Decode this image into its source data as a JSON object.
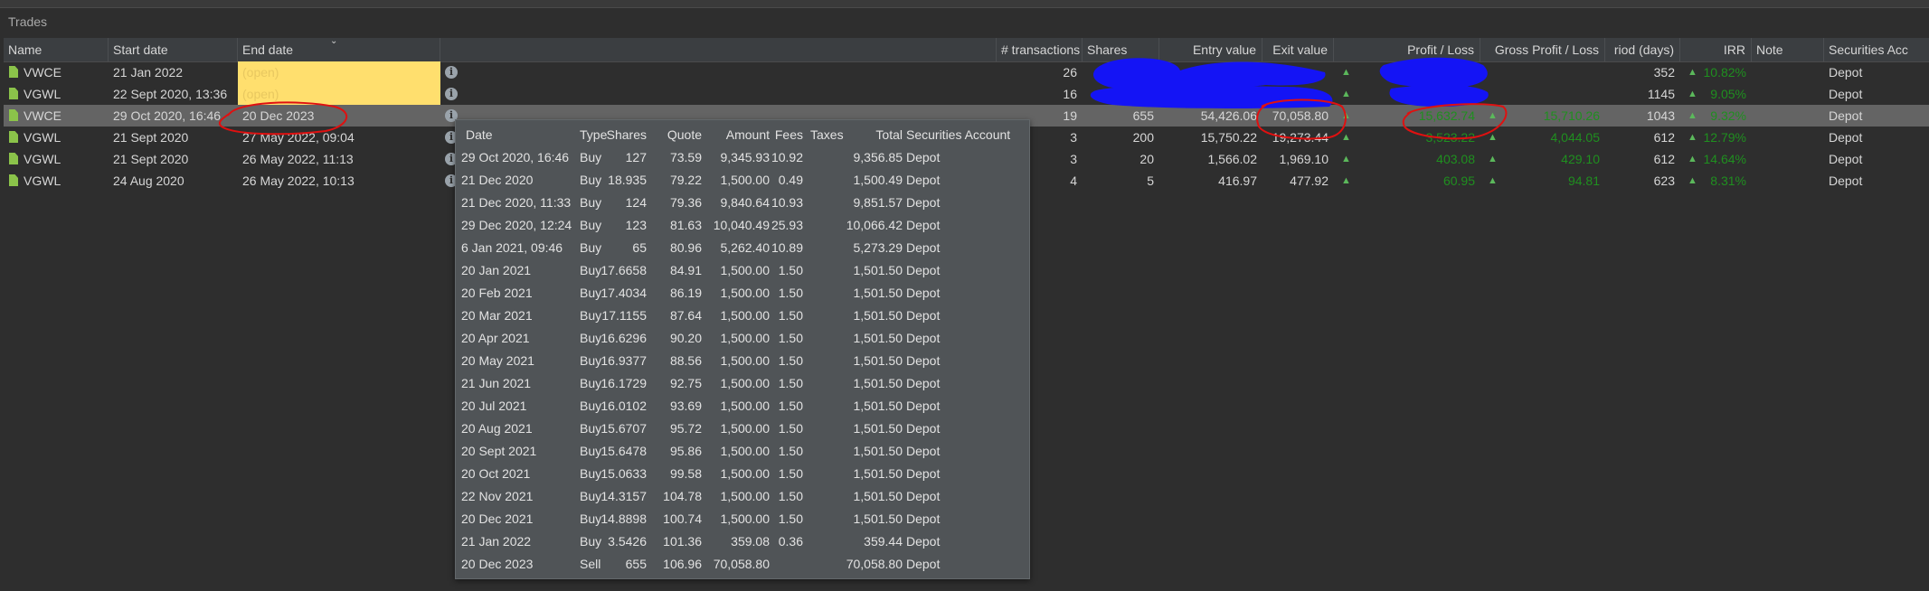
{
  "panel_title": "Trades",
  "columns": {
    "name": "Name",
    "start": "Start date",
    "end": "End date",
    "trans": "# transactions",
    "shares": "Shares",
    "entry": "Entry value",
    "exit": "Exit value",
    "pl": "Profit / Loss",
    "gross": "Gross Profit / Loss",
    "period": "riod (days)",
    "irr": "IRR",
    "note": "Note",
    "acc": "Securities Acc"
  },
  "rows": [
    {
      "name": "VWCE",
      "start": "21 Jan 2022",
      "end": "(open)",
      "trans": "26",
      "shares": "",
      "entry": "",
      "exit": "",
      "pl": "",
      "gross": "",
      "period": "352",
      "irr": "10.82%",
      "acc": "Depot"
    },
    {
      "name": "VGWL",
      "start": "22 Sept 2020, 13:36",
      "end": "(open)",
      "trans": "16",
      "shares": "",
      "entry": "",
      "exit": "",
      "pl": "",
      "gross": "",
      "period": "1145",
      "irr": "9.05%",
      "acc": "Depot"
    },
    {
      "name": "VWCE",
      "start": "29 Oct 2020, 16:46",
      "end": "20 Dec 2023",
      "trans": "19",
      "shares": "655",
      "entry": "54,426.06",
      "exit": "70,058.80",
      "pl": "15,632.74",
      "gross": "15,710.26",
      "period": "1043",
      "irr": "9.32%",
      "acc": "Depot"
    },
    {
      "name": "VGWL",
      "start": "21 Sept 2020",
      "end": "27 May 2022, 09:04",
      "trans": "3",
      "shares": "200",
      "entry": "15,750.22",
      "exit": "19,273.44",
      "pl": "3,523.22",
      "gross": "4,044.05",
      "period": "612",
      "irr": "12.79%",
      "acc": "Depot"
    },
    {
      "name": "VGWL",
      "start": "21 Sept 2020",
      "end": "26 May 2022, 11:13",
      "trans": "3",
      "shares": "20",
      "entry": "1,566.02",
      "exit": "1,969.10",
      "pl": "403.08",
      "gross": "429.10",
      "period": "612",
      "irr": "14.64%",
      "acc": "Depot"
    },
    {
      "name": "VGWL",
      "start": "24 Aug 2020",
      "end": "26 May 2022, 10:13",
      "trans": "4",
      "shares": "5",
      "entry": "416.97",
      "exit": "477.92",
      "pl": "60.95",
      "gross": "94.81",
      "period": "623",
      "irr": "8.31%",
      "acc": "Depot"
    }
  ],
  "icons": {
    "arrow": "▲",
    "info": "i",
    "sort": "⌄"
  },
  "tooltip": {
    "headers": {
      "date": "Date",
      "type": "Type",
      "shares": "Shares",
      "quote": "Quote",
      "amount": "Amount",
      "fees": "Fees",
      "taxes": "Taxes",
      "total": "Total",
      "acc": "Securities Account"
    },
    "rows": [
      {
        "date": "29 Oct 2020, 16:46",
        "type": "Buy",
        "shares": "127",
        "quote": "73.59",
        "amount": "9,345.93",
        "fees": "10.92",
        "total": "9,356.85",
        "acc": "Depot"
      },
      {
        "date": "21 Dec 2020",
        "type": "Buy",
        "shares": "18.935",
        "quote": "79.22",
        "amount": "1,500.00",
        "fees": "0.49",
        "total": "1,500.49",
        "acc": "Depot"
      },
      {
        "date": "21 Dec 2020, 11:33",
        "type": "Buy",
        "shares": "124",
        "quote": "79.36",
        "amount": "9,840.64",
        "fees": "10.93",
        "total": "9,851.57",
        "acc": "Depot"
      },
      {
        "date": "29 Dec 2020, 12:24",
        "type": "Buy",
        "shares": "123",
        "quote": "81.63",
        "amount": "10,040.49",
        "fees": "25.93",
        "total": "10,066.42",
        "acc": "Depot"
      },
      {
        "date": "6 Jan 2021, 09:46",
        "type": "Buy",
        "shares": "65",
        "quote": "80.96",
        "amount": "5,262.40",
        "fees": "10.89",
        "total": "5,273.29",
        "acc": "Depot"
      },
      {
        "date": "20 Jan 2021",
        "type": "Buy",
        "shares": "17.6658",
        "quote": "84.91",
        "amount": "1,500.00",
        "fees": "1.50",
        "total": "1,501.50",
        "acc": "Depot"
      },
      {
        "date": "20 Feb 2021",
        "type": "Buy",
        "shares": "17.4034",
        "quote": "86.19",
        "amount": "1,500.00",
        "fees": "1.50",
        "total": "1,501.50",
        "acc": "Depot"
      },
      {
        "date": "20 Mar 2021",
        "type": "Buy",
        "shares": "17.1155",
        "quote": "87.64",
        "amount": "1,500.00",
        "fees": "1.50",
        "total": "1,501.50",
        "acc": "Depot"
      },
      {
        "date": "20 Apr 2021",
        "type": "Buy",
        "shares": "16.6296",
        "quote": "90.20",
        "amount": "1,500.00",
        "fees": "1.50",
        "total": "1,501.50",
        "acc": "Depot"
      },
      {
        "date": "20 May 2021",
        "type": "Buy",
        "shares": "16.9377",
        "quote": "88.56",
        "amount": "1,500.00",
        "fees": "1.50",
        "total": "1,501.50",
        "acc": "Depot"
      },
      {
        "date": "21 Jun 2021",
        "type": "Buy",
        "shares": "16.1729",
        "quote": "92.75",
        "amount": "1,500.00",
        "fees": "1.50",
        "total": "1,501.50",
        "acc": "Depot"
      },
      {
        "date": "20 Jul 2021",
        "type": "Buy",
        "shares": "16.0102",
        "quote": "93.69",
        "amount": "1,500.00",
        "fees": "1.50",
        "total": "1,501.50",
        "acc": "Depot"
      },
      {
        "date": "20 Aug 2021",
        "type": "Buy",
        "shares": "15.6707",
        "quote": "95.72",
        "amount": "1,500.00",
        "fees": "1.50",
        "total": "1,501.50",
        "acc": "Depot"
      },
      {
        "date": "20 Sept 2021",
        "type": "Buy",
        "shares": "15.6478",
        "quote": "95.86",
        "amount": "1,500.00",
        "fees": "1.50",
        "total": "1,501.50",
        "acc": "Depot"
      },
      {
        "date": "20 Oct 2021",
        "type": "Buy",
        "shares": "15.0633",
        "quote": "99.58",
        "amount": "1,500.00",
        "fees": "1.50",
        "total": "1,501.50",
        "acc": "Depot"
      },
      {
        "date": "22 Nov 2021",
        "type": "Buy",
        "shares": "14.3157",
        "quote": "104.78",
        "amount": "1,500.00",
        "fees": "1.50",
        "total": "1,501.50",
        "acc": "Depot"
      },
      {
        "date": "20 Dec 2021",
        "type": "Buy",
        "shares": "14.8898",
        "quote": "100.74",
        "amount": "1,500.00",
        "fees": "1.50",
        "total": "1,501.50",
        "acc": "Depot"
      },
      {
        "date": "21 Jan 2022",
        "type": "Buy",
        "shares": "3.5426",
        "quote": "101.36",
        "amount": "359.08",
        "fees": "0.36",
        "total": "359.44",
        "acc": "Depot"
      },
      {
        "date": "20 Dec 2023",
        "type": "Sell",
        "shares": "655",
        "quote": "106.96",
        "amount": "70,058.80",
        "fees": "",
        "total": "70,058.80",
        "acc": "Depot"
      }
    ]
  },
  "colors": {
    "accent_green": "#1f8f1f",
    "open_highlight": "#ffdf6e",
    "redaction": "#1010ff",
    "annotation": "#e01010"
  }
}
